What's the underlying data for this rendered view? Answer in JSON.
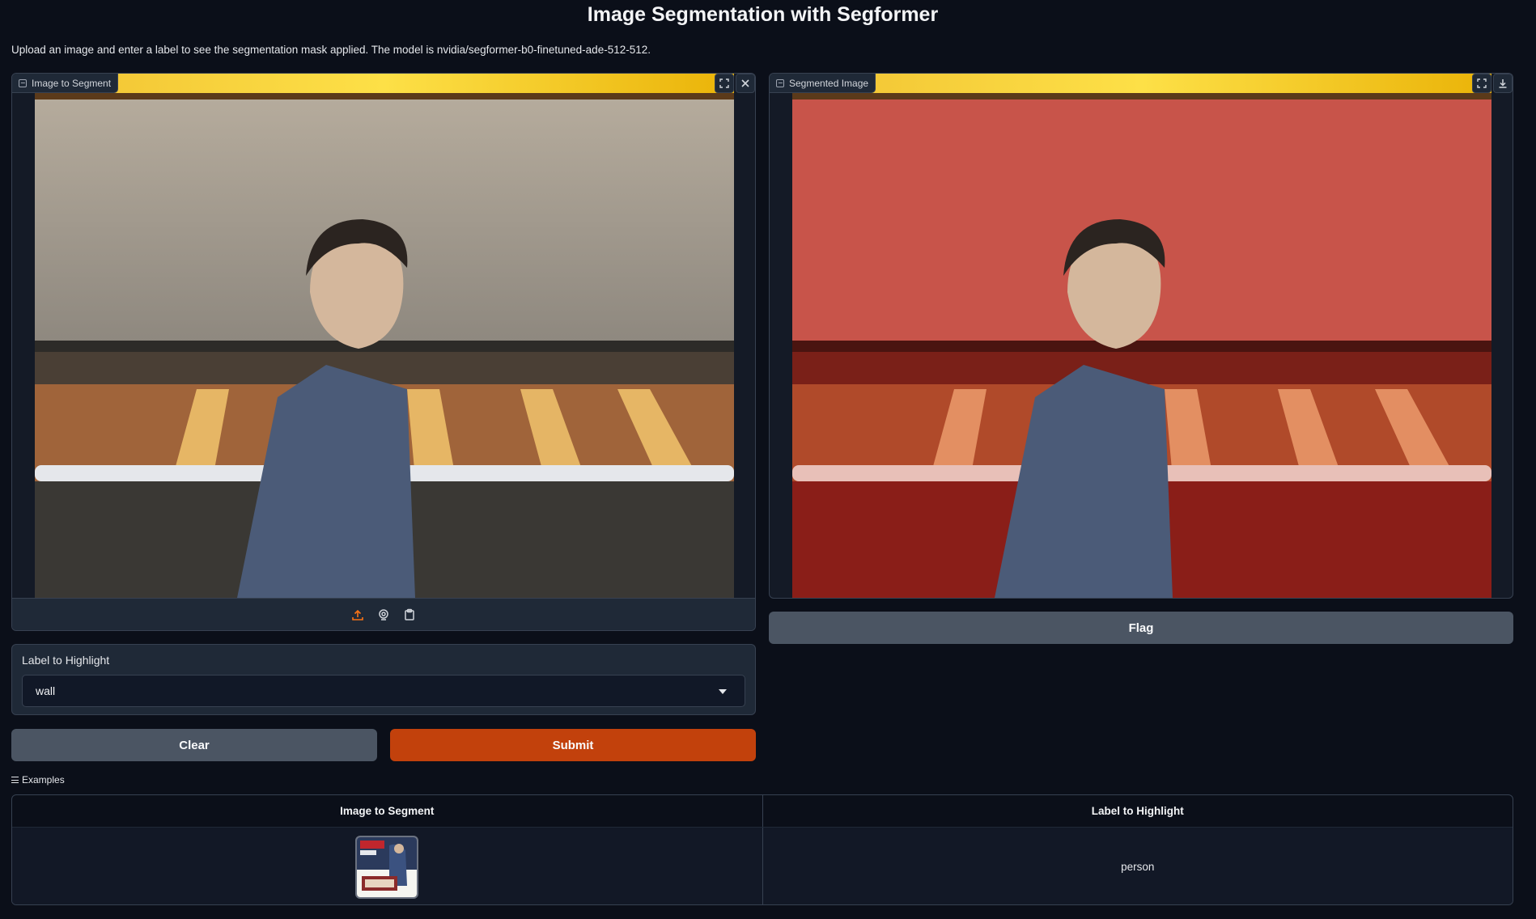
{
  "page": {
    "title": "Image Segmentation with Segformer",
    "description": "Upload an image and enter a label to see the segmentation mask applied. The model is nvidia/segformer-b0-finetuned-ade-512-512."
  },
  "input_image": {
    "label": "Image to Segment",
    "icons": [
      "fullscreen-icon",
      "close-icon",
      "upload-icon",
      "webcam-icon",
      "clipboard-icon"
    ]
  },
  "output_image": {
    "label": "Segmented Image",
    "icons": [
      "fullscreen-icon",
      "download-icon"
    ]
  },
  "label_select": {
    "label": "Label to Highlight",
    "value": "wall"
  },
  "buttons": {
    "clear": "Clear",
    "submit": "Submit",
    "flag": "Flag"
  },
  "examples": {
    "title": "Examples",
    "headers": [
      "Image to Segment",
      "Label to Highlight"
    ],
    "rows": [
      {
        "label": "person"
      }
    ]
  },
  "colors": {
    "background": "#0b0f19",
    "panel": "#1f2937",
    "accent": "#c2410c",
    "secondary_button": "#4b5563",
    "mask_tint": "#dc2626"
  }
}
